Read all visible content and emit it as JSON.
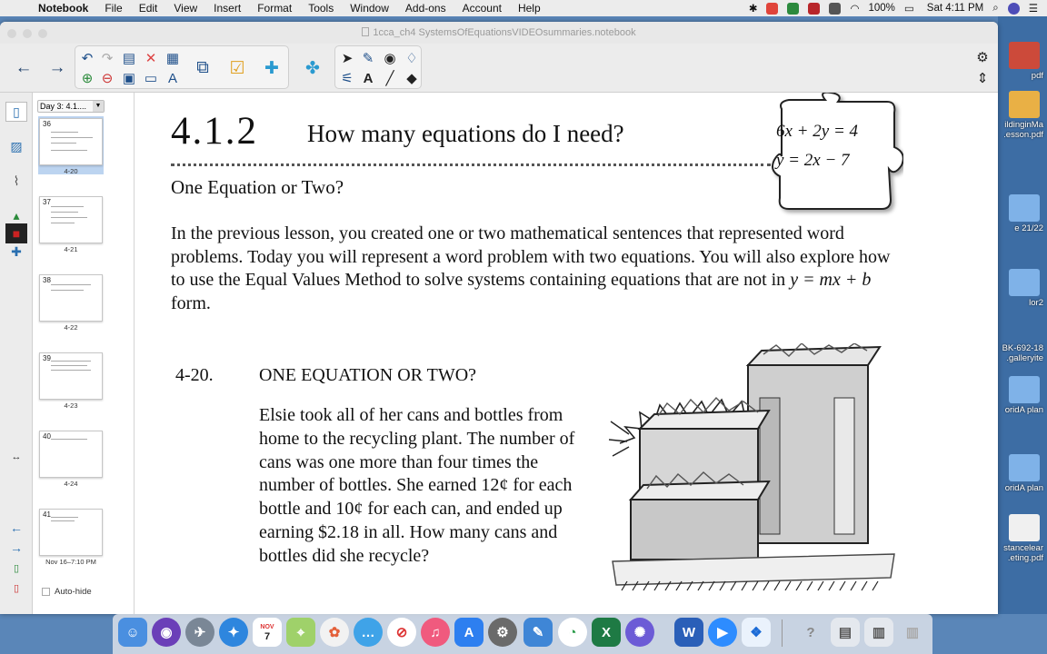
{
  "menubar": {
    "app_name": "Notebook",
    "items": [
      "File",
      "Edit",
      "View",
      "Insert",
      "Format",
      "Tools",
      "Window",
      "Add-ons",
      "Account",
      "Help"
    ],
    "battery": "100%",
    "clock": "Sat 4:11 PM"
  },
  "window": {
    "doc_title": "1cca_ch4 SystemsOfEquationsVIDEOsummaries.notebook"
  },
  "sorter": {
    "selected_page": "Day 3: 4.1....",
    "thumbnails": [
      {
        "num": "36",
        "label": "4-20"
      },
      {
        "num": "37",
        "label": "4-21"
      },
      {
        "num": "38",
        "label": "4-22"
      },
      {
        "num": "39",
        "label": "4-23"
      },
      {
        "num": "40",
        "label": "4-24"
      },
      {
        "num": "41",
        "label": "Nov 16–7:10 PM"
      }
    ],
    "auto_hide_label": "Auto-hide"
  },
  "page": {
    "lesson_number": "4.1.2",
    "lesson_title": "How many equations do I need?",
    "puzzle_eq1": "6x + 2y = 4",
    "puzzle_eq2": "y = 2x − 7",
    "subheading": "One Equation or Two?",
    "intro_part1": "In the previous lesson, you created one or two mathematical sentences that represented word problems.  Today you will represent a word problem with two equations.  You will also explore how to use the Equal Values Method to solve systems containing equations that are not in ",
    "intro_form": "y = mx + b",
    "intro_part2": " form.",
    "problem_number": "4-20.",
    "problem_title": "ONE EQUATION OR TWO?",
    "problem_body": "Elsie took all of her cans and bottles from home to the recycling plant.  The number of cans was one more than four times the number of bottles.  She earned 12¢ for each bottle and 10¢ for each can, and ended up earning $2.18 in all.  How many cans and bottles did she recycle?"
  },
  "desktop_files": [
    {
      "label": "pdf"
    },
    {
      "label": "ildinginMa .esson.pdf"
    },
    {
      "label": "e 21/22"
    },
    {
      "label": "lor2"
    },
    {
      "label": "BK-692-18 .galleryite"
    },
    {
      "label": "oridA plan"
    },
    {
      "label": "oridA plan"
    },
    {
      "label": "stancelear .eting.pdf"
    }
  ],
  "dock_badges": {
    "calendar_month": "NOV",
    "calendar_day": "7"
  },
  "colors": {
    "accent": "#2a6fb0",
    "desktop": "#5a86b8",
    "selection": "#bcd4f0"
  }
}
